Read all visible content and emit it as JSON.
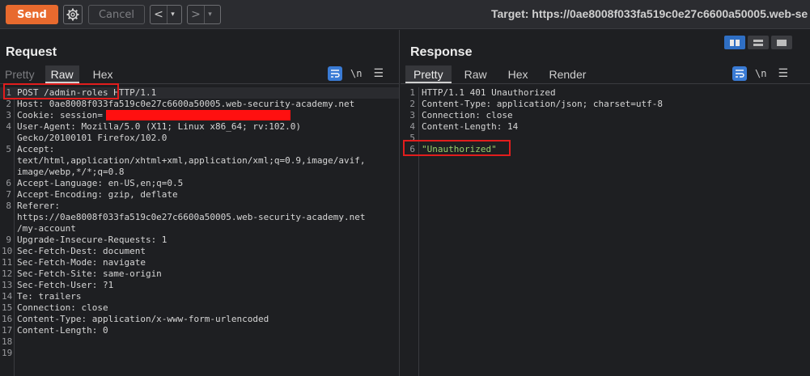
{
  "toolbar": {
    "send_label": "Send",
    "cancel_label": "Cancel",
    "prev_arrow": "<",
    "next_arrow": ">",
    "caret": "▾",
    "target_text": "Target: https://0ae8008f033fa519c0e27c6600a50005.web-se"
  },
  "request": {
    "title": "Request",
    "tabs": [
      "Pretty",
      "Raw",
      "Hex"
    ],
    "active_tab": "Raw",
    "newline_label": "\\n",
    "lines": [
      {
        "n": "1",
        "text": "POST /admin-roles HTTP/1.1"
      },
      {
        "n": "2",
        "text": "Host: 0ae8008f033fa519c0e27c6600a50005.web-security-academy.net"
      },
      {
        "n": "3",
        "text": "Cookie: session="
      },
      {
        "n": "4",
        "text": "User-Agent: Mozilla/5.0 (X11; Linux x86_64; rv:102.0)"
      },
      {
        "n": "",
        "text": "Gecko/20100101 Firefox/102.0"
      },
      {
        "n": "5",
        "text": "Accept:"
      },
      {
        "n": "",
        "text": "text/html,application/xhtml+xml,application/xml;q=0.9,image/avif,"
      },
      {
        "n": "",
        "text": "image/webp,*/*;q=0.8"
      },
      {
        "n": "6",
        "text": "Accept-Language: en-US,en;q=0.5"
      },
      {
        "n": "7",
        "text": "Accept-Encoding: gzip, deflate"
      },
      {
        "n": "8",
        "text": "Referer:"
      },
      {
        "n": "",
        "text": "https://0ae8008f033fa519c0e27c6600a50005.web-security-academy.net"
      },
      {
        "n": "",
        "text": "/my-account"
      },
      {
        "n": "9",
        "text": "Upgrade-Insecure-Requests: 1"
      },
      {
        "n": "10",
        "text": "Sec-Fetch-Dest: document"
      },
      {
        "n": "11",
        "text": "Sec-Fetch-Mode: navigate"
      },
      {
        "n": "12",
        "text": "Sec-Fetch-Site: same-origin"
      },
      {
        "n": "13",
        "text": "Sec-Fetch-User: ?1"
      },
      {
        "n": "14",
        "text": "Te: trailers"
      },
      {
        "n": "15",
        "text": "Connection: close"
      },
      {
        "n": "16",
        "text": "Content-Type: application/x-www-form-urlencoded"
      },
      {
        "n": "17",
        "text": "Content-Length: 0"
      },
      {
        "n": "18",
        "text": ""
      },
      {
        "n": "19",
        "text": ""
      }
    ]
  },
  "response": {
    "title": "Response",
    "tabs": [
      "Pretty",
      "Raw",
      "Hex",
      "Render"
    ],
    "active_tab": "Pretty",
    "newline_label": "\\n",
    "lines": [
      {
        "n": "1",
        "text": "HTTP/1.1 401 Unauthorized"
      },
      {
        "n": "2",
        "text": "Content-Type: application/json; charset=utf-8"
      },
      {
        "n": "3",
        "text": "Connection: close"
      },
      {
        "n": "4",
        "text": "Content-Length: 14"
      },
      {
        "n": "5",
        "text": ""
      },
      {
        "n": "6",
        "text": "\"Unauthorized\""
      }
    ]
  },
  "colors": {
    "send": "#e86a2e",
    "accent": "#3a7bd5",
    "highlight_box": "#e11d1d",
    "string": "#9bcf6b"
  }
}
